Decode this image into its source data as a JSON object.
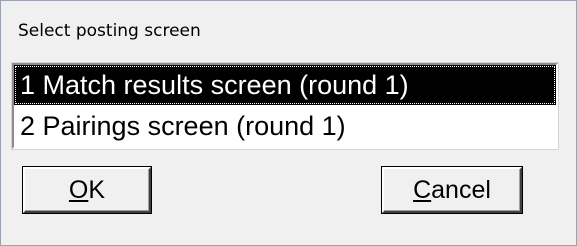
{
  "dialog": {
    "title": "Select posting screen",
    "list": {
      "items": [
        {
          "label": "1  Match results screen (round 1)",
          "selected": true
        },
        {
          "label": "2  Pairings screen (round 1)",
          "selected": false
        }
      ]
    },
    "buttons": {
      "ok": {
        "mnemonic": "O",
        "rest": "K"
      },
      "cancel": {
        "mnemonic": "C",
        "rest": "ancel"
      }
    }
  }
}
